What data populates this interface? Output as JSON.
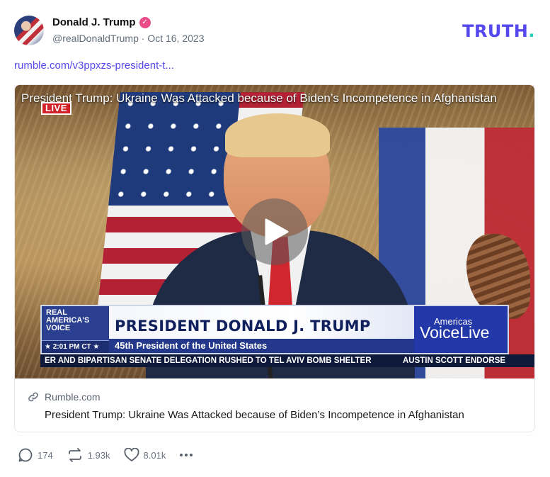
{
  "post": {
    "author_name": "Donald J. Trump",
    "verified_mark": "✓",
    "handle": "@realDonaldTrump",
    "separator": "·",
    "date": "Oct 16, 2023",
    "link_text": "rumble.com/v3ppxzs-president-t..."
  },
  "brand": {
    "logo_text": "TRUTH",
    "logo_dot": "."
  },
  "video": {
    "title": "President Trump: Ukraine Was Attacked because of Biden’s Incompetence in Afghanistan",
    "live_badge": "LIVE",
    "chyron": {
      "network_line1": "REAL",
      "network_line2": "AMERICA'S",
      "network_line3": "VOICE",
      "time": "★ 2:01 PM CT ★",
      "headline": "PRESIDENT DONALD J. TRUMP",
      "subheadline": "45th President of the United States",
      "brand_small": "Americas",
      "brand_big": "VoiceLive"
    },
    "ticker_left": "ER AND BIPARTISAN SENATE DELEGATION RUSHED TO TEL AVIV BOMB SHELTER",
    "ticker_right": "AUSTIN SCOTT ENDORSE"
  },
  "preview": {
    "domain": "Rumble.com",
    "title": "President Trump: Ukraine Was Attacked because of Biden’s Incompetence in Afghanistan"
  },
  "actions": {
    "replies": "174",
    "retruths": "1.93k",
    "likes": "8.01k"
  },
  "colors": {
    "accent": "#5448ee",
    "verified": "#ea4c89",
    "logo_dot": "#20d0b9"
  },
  "icons": [
    "verified-badge-icon",
    "play-icon",
    "link-icon",
    "reply-icon",
    "retruth-icon",
    "like-icon",
    "more-icon"
  ]
}
